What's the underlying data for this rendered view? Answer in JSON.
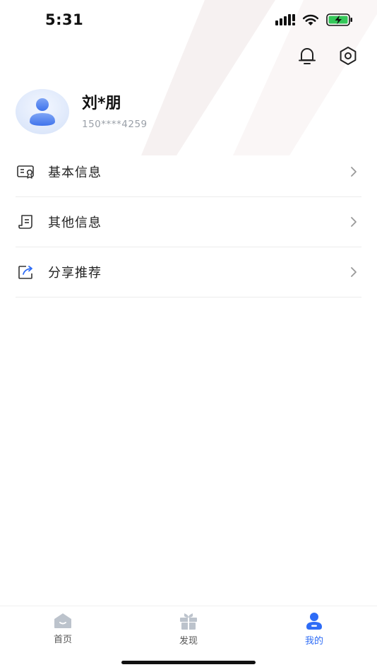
{
  "status_bar": {
    "time": "5:31"
  },
  "profile": {
    "name": "刘*朋",
    "phone": "150****4259"
  },
  "menu": {
    "items": [
      {
        "label": "基本信息"
      },
      {
        "label": "其他信息"
      },
      {
        "label": "分享推荐"
      }
    ]
  },
  "tabbar": {
    "tabs": [
      {
        "label": "首页",
        "active": false
      },
      {
        "label": "发现",
        "active": false
      },
      {
        "label": "我的",
        "active": true
      }
    ]
  },
  "colors": {
    "accent": "#2e6cf6",
    "icon_gray": "#bcc3cc",
    "battery_green": "#34c759"
  }
}
